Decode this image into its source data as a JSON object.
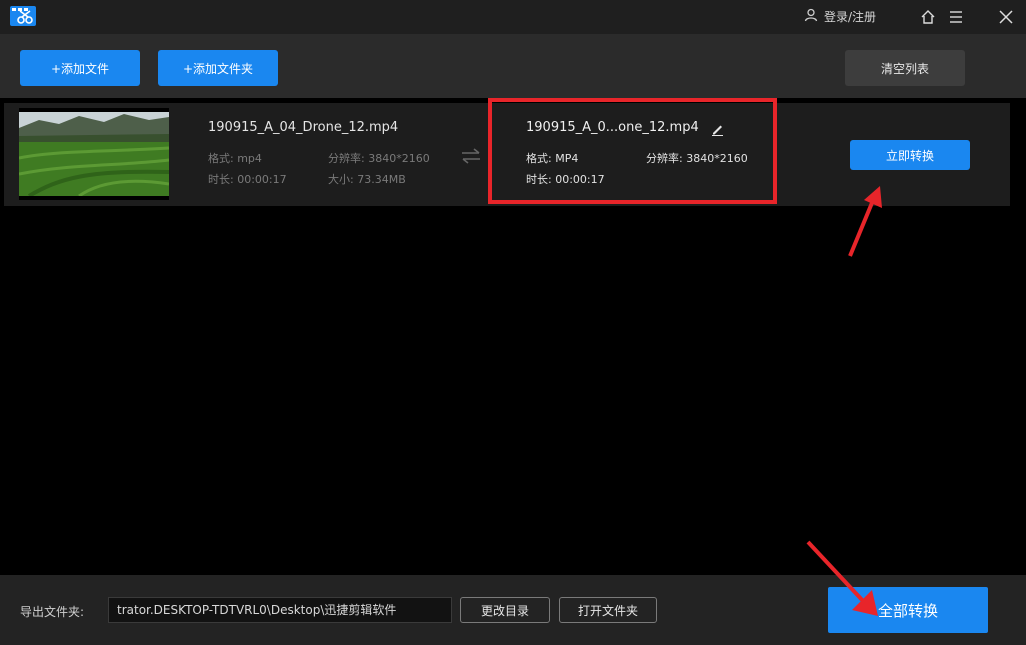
{
  "titlebar": {
    "login_label": "登录/注册",
    "icons": [
      "app-logo-icon",
      "user-icon",
      "home-icon",
      "menu-icon",
      "close-icon"
    ]
  },
  "toolbar": {
    "add_file_label": "+添加文件",
    "add_folder_label": "+添加文件夹",
    "clear_list_label": "清空列表"
  },
  "file_row": {
    "source": {
      "name": "190915_A_04_Drone_12.mp4",
      "format_label": "格式:",
      "format_value": "mp4",
      "resolution_label": "分辨率:",
      "resolution_value": "3840*2160",
      "duration_label": "时长:",
      "duration_value": "00:00:17",
      "size_label": "大小:",
      "size_value": "73.34MB"
    },
    "output": {
      "name": "190915_A_0...one_12.mp4",
      "format_label": "格式:",
      "format_value": "MP4",
      "resolution_label": "分辨率:",
      "resolution_value": "3840*2160",
      "duration_label": "时长:",
      "duration_value": "00:00:17"
    },
    "convert_now_label": "立即转换"
  },
  "bottombar": {
    "export_label": "导出文件夹:",
    "export_path": "trator.DESKTOP-TDTVRL0\\Desktop\\迅捷剪辑软件",
    "change_dir_label": "更改目录",
    "open_folder_label": "打开文件夹",
    "convert_all_label": "全部转换"
  },
  "colors": {
    "accent": "#1a87f0",
    "highlight": "#e8252a",
    "background": "#000000"
  }
}
